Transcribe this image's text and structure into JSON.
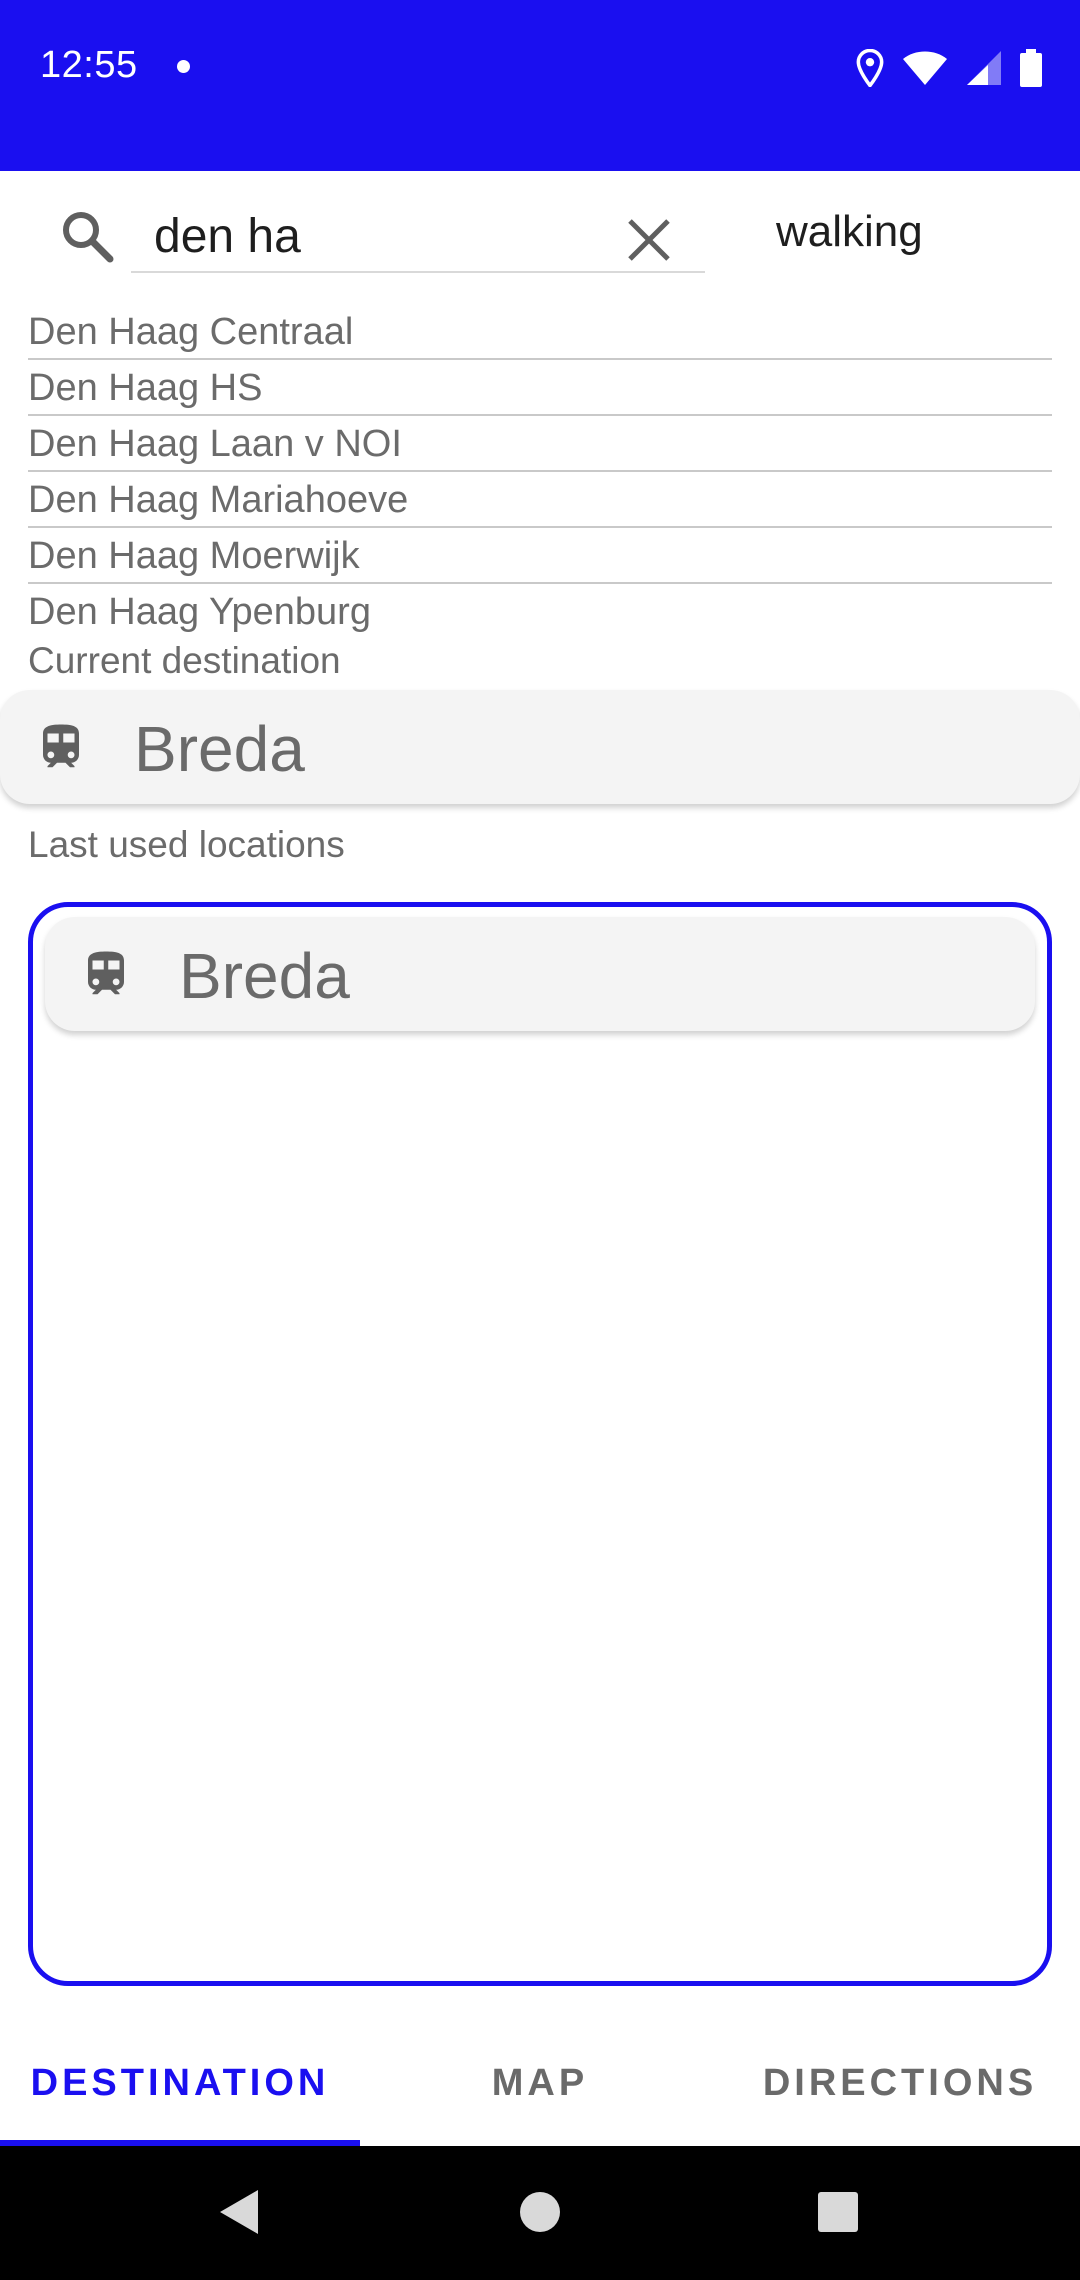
{
  "status_bar": {
    "time": "12:55",
    "background": "#1a0ff0"
  },
  "search": {
    "value": "den ha",
    "mode": "walking",
    "icon": "search-icon",
    "clear_icon": "close-icon"
  },
  "suggestions": [
    "Den Haag Centraal",
    "Den Haag HS",
    "Den Haag Laan v NOI",
    "Den Haag Mariahoeve",
    "Den Haag Moerwijk",
    "Den Haag Ypenburg"
  ],
  "current_destination": {
    "label": "Current destination",
    "name": "Breda",
    "icon": "train-icon"
  },
  "last_used": {
    "label": "Last used locations",
    "items": [
      {
        "name": "Breda",
        "icon": "train-icon"
      }
    ]
  },
  "tabs": [
    {
      "label": "DESTINATION",
      "active": true
    },
    {
      "label": "MAP",
      "active": false
    },
    {
      "label": "DIRECTIONS",
      "active": false
    }
  ],
  "colors": {
    "accent": "#1a0ff0",
    "secondary_text": "#6b6b6b"
  }
}
